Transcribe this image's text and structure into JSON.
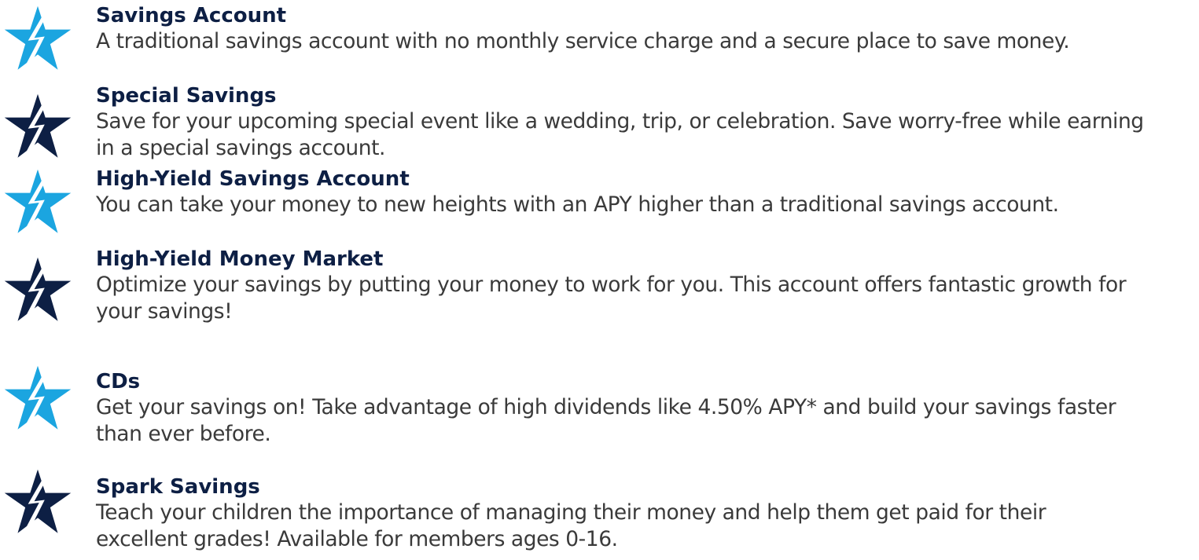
{
  "colors": {
    "light_blue": "#1ba5e0",
    "navy": "#0d1f44",
    "title_text": "#0d1f44",
    "body_text": "#3a3a3a"
  },
  "items": [
    {
      "icon": "star-bolt-icon",
      "icon_color": "#1ba5e0",
      "title": "Savings Account",
      "desc_lines": [
        "A traditional savings account with no monthly service charge and a secure place to save money."
      ]
    },
    {
      "icon": "star-bolt-icon",
      "icon_color": "#0d1f44",
      "title": "Special Savings",
      "desc_lines": [
        "Save for your upcoming special event like a wedding, trip, or celebration. Save worry-free while earning",
        "in a special savings account."
      ]
    },
    {
      "icon": "star-bolt-icon",
      "icon_color": "#1ba5e0",
      "title": "High-Yield Savings Account",
      "desc_lines": [
        "You can take your money to new heights with an APY higher than a traditional savings account."
      ]
    },
    {
      "icon": "star-bolt-icon",
      "icon_color": "#0d1f44",
      "title": "High-Yield Money Market",
      "desc_lines": [
        "Optimize your savings by putting your money to work for you. This account offers fantastic growth for",
        "your savings!"
      ]
    },
    {
      "icon": "star-bolt-icon",
      "icon_color": "#1ba5e0",
      "title": "CDs",
      "desc_lines": [
        "Get your savings on! Take advantage of high dividends like 4.50% APY* and build your savings faster",
        "than ever before."
      ]
    },
    {
      "icon": "star-bolt-icon",
      "icon_color": "#0d1f44",
      "title": "Spark Savings",
      "desc_lines": [
        "Teach your children the importance of managing their money and help them get paid for their",
        "excellent grades! Available for members ages 0-16."
      ]
    }
  ]
}
